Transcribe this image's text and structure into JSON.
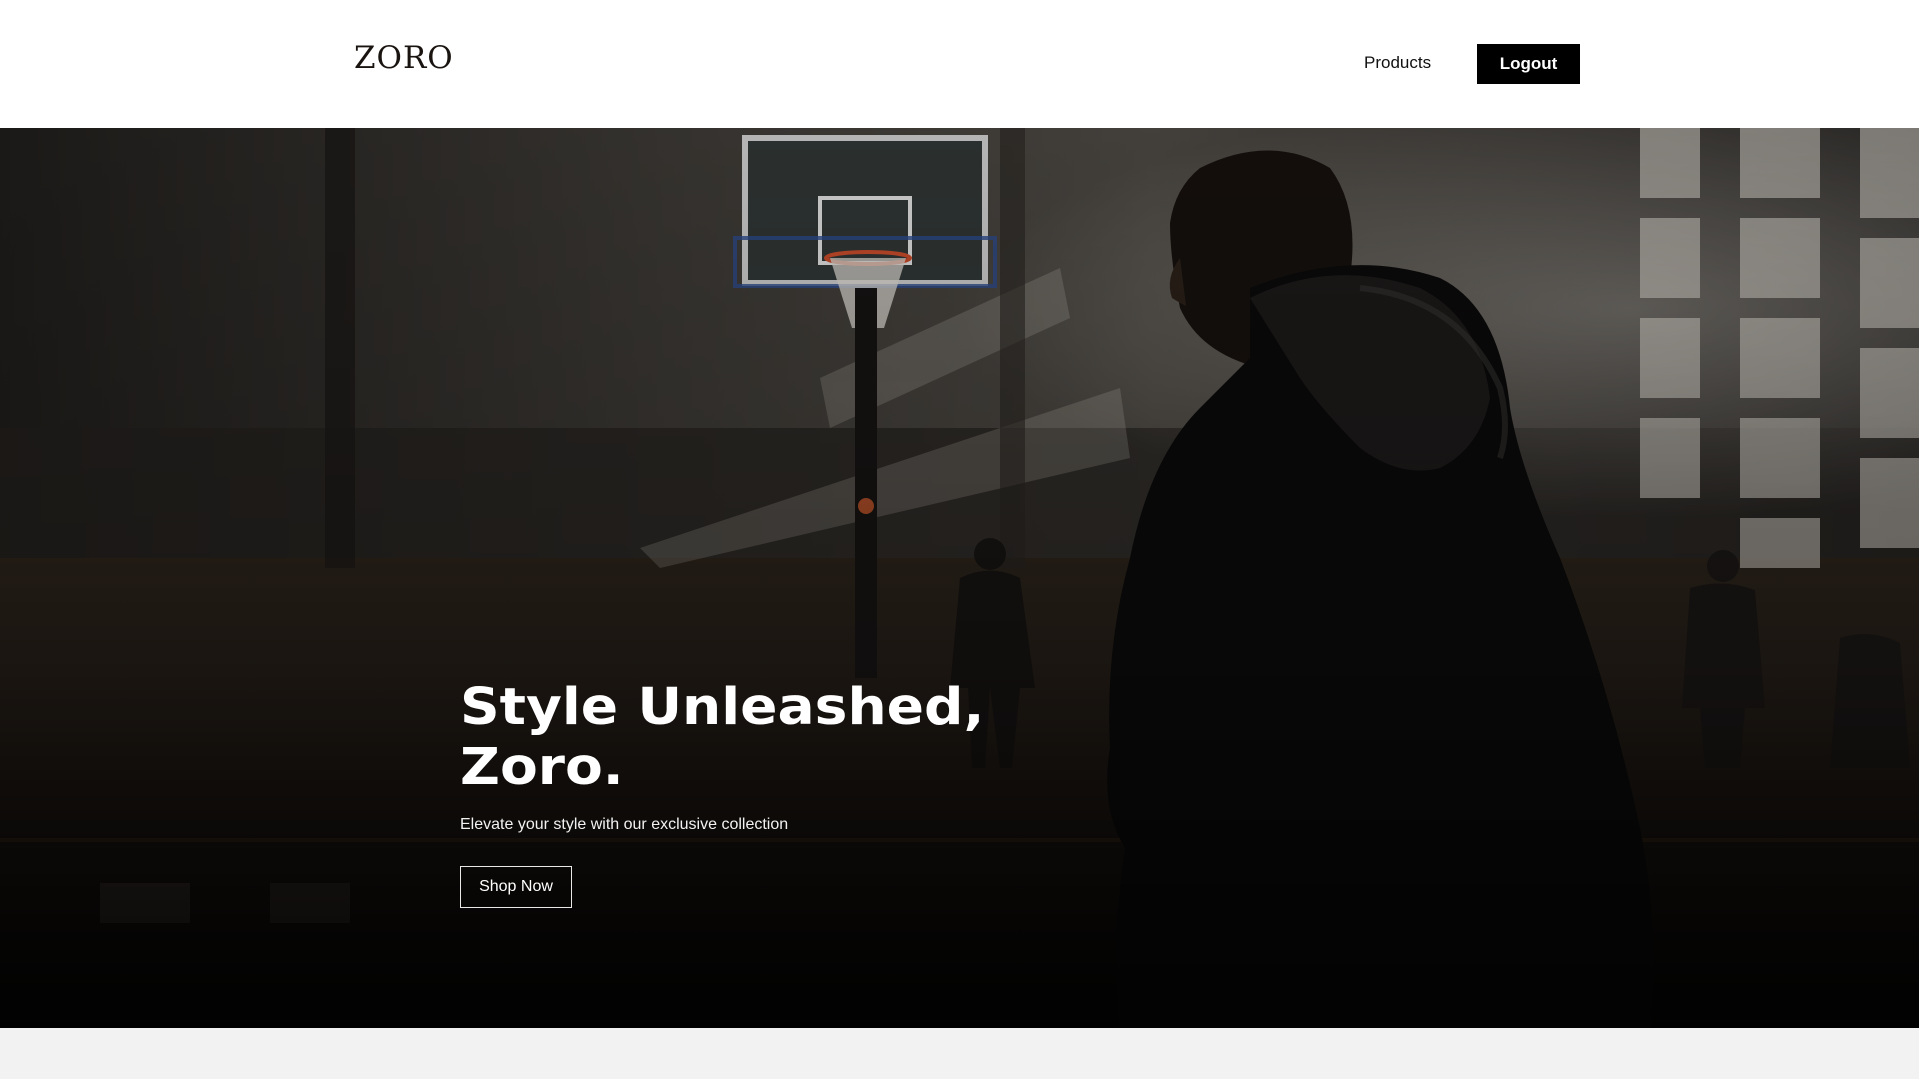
{
  "header": {
    "logo": "ZORO",
    "nav_products": "Products",
    "logout_label": "Logout"
  },
  "hero": {
    "title_line1": "Style Unleashed,",
    "title_line2": "Zoro.",
    "subtitle": "Elevate your style with our exclusive collection",
    "cta_label": "Shop Now",
    "image_description_icon": "hero-photo"
  },
  "colors": {
    "header_bg": "#ffffff",
    "logout_bg": "#000000",
    "hero_bg": "#141211",
    "below_bg": "#f2f2f2"
  }
}
